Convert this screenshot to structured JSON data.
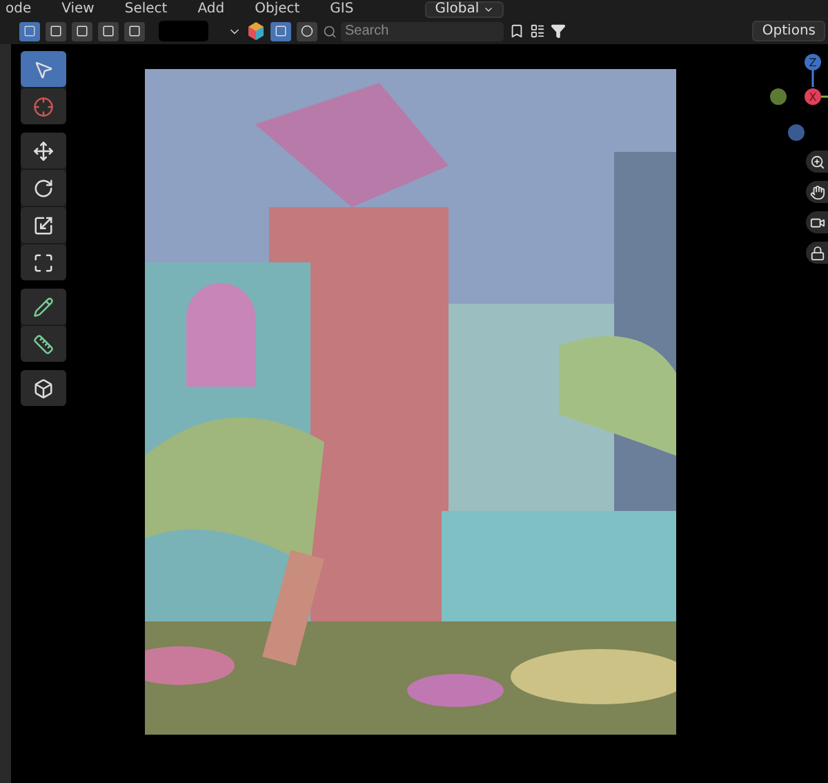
{
  "menu": [
    {
      "label": "ode"
    },
    {
      "label": "View"
    },
    {
      "label": "Select"
    },
    {
      "label": "Add"
    },
    {
      "label": "Object"
    },
    {
      "label": "GIS"
    }
  ],
  "orientation": {
    "label": "Global"
  },
  "search": {
    "placeholder": "Search"
  },
  "options_button": {
    "label": "Options"
  },
  "tools": [
    [
      {
        "kind": "select",
        "selected": true
      },
      {
        "kind": "cursor",
        "selected": false
      }
    ],
    [
      {
        "kind": "move",
        "selected": false
      },
      {
        "kind": "rotate",
        "selected": false
      },
      {
        "kind": "scale",
        "selected": false
      },
      {
        "kind": "transform",
        "selected": false
      }
    ],
    [
      {
        "kind": "annotate",
        "selected": false
      },
      {
        "kind": "measure",
        "selected": false
      }
    ],
    [
      {
        "kind": "add-cube",
        "selected": false
      }
    ]
  ],
  "gizmo": {
    "axes": [
      {
        "label": "Z"
      },
      {
        "label": "X"
      }
    ]
  },
  "viewport": {
    "kind": "picture"
  }
}
